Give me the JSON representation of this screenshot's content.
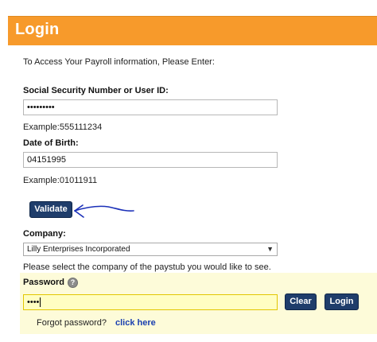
{
  "header": {
    "title": "Login"
  },
  "form": {
    "intro_text": "To Access Your Payroll information, Please Enter:",
    "ssn": {
      "label": "Social Security Number or User ID:",
      "value": "•••••••••",
      "example": "Example:555111234"
    },
    "dob": {
      "label": "Date of Birth:",
      "value": "04151995",
      "example": "Example:01011911"
    },
    "validate_label": "Validate",
    "company": {
      "label": "Company:",
      "selected": "Lilly Enterprises Incorporated",
      "hint": "Please select the company of the paystub you would like to see."
    },
    "password": {
      "label": "Password",
      "value": "••••",
      "help_icon": "?"
    },
    "clear_label": "Clear",
    "login_label": "Login",
    "forgot_text": "Forgot password?",
    "click_here_text": "click here"
  },
  "colors": {
    "header_orange": "#f79a2b",
    "button_navy": "#1f3d6b",
    "password_panel": "#fdfbd9",
    "annotation_arrow": "#1a2fb8",
    "link_blue": "#1a3fb0"
  }
}
